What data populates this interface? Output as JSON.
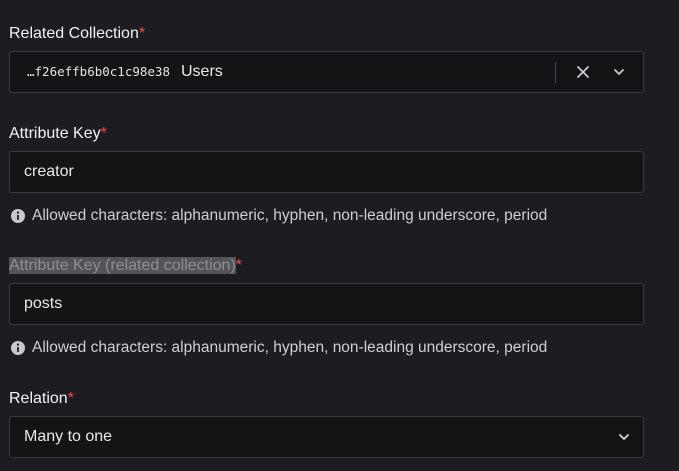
{
  "related_collection": {
    "label": "Related Collection",
    "required_mark": "*",
    "selected_id": "…f26effb6b0c1c98e38",
    "selected_name": "Users",
    "clear_icon": "close-icon",
    "dropdown_icon": "chevron-down-icon"
  },
  "attribute_key": {
    "label": "Attribute Key",
    "required_mark": "*",
    "value": "creator",
    "hint": "Allowed characters: alphanumeric, hyphen, non-leading underscore, period",
    "hint_icon": "info-icon"
  },
  "attribute_key_related": {
    "label": "Attribute Key (related collection)",
    "required_mark": "*",
    "value": "posts",
    "hint": "Allowed characters: alphanumeric, hyphen, non-leading underscore, period",
    "hint_icon": "info-icon"
  },
  "relation": {
    "label": "Relation",
    "required_mark": "*",
    "value": "Many to one",
    "dropdown_icon": "chevron-down-icon"
  },
  "colors": {
    "background": "#1d1d21",
    "input_background": "#141417",
    "input_border": "#3a3a3f",
    "required": "#f5464b",
    "label_highlight": "#545458"
  }
}
